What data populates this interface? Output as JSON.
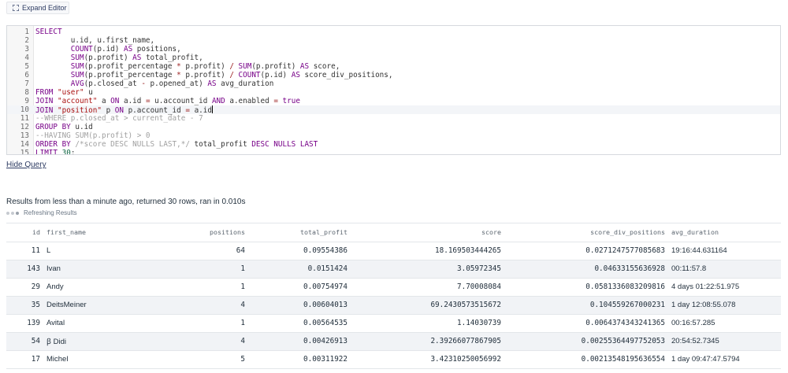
{
  "toolbar": {
    "expand_label": "Expand Editor",
    "hide_query_label": "Hide Query"
  },
  "editor": {
    "lines": [
      {
        "n": "1",
        "segments": [
          {
            "t": "SELECT",
            "c": "kw"
          }
        ]
      },
      {
        "n": "2",
        "segments": [
          {
            "t": "        u.id, u.first_name,",
            "c": ""
          }
        ]
      },
      {
        "n": "3",
        "segments": [
          {
            "t": "        ",
            "c": ""
          },
          {
            "t": "COUNT",
            "c": "kw"
          },
          {
            "t": "(p.id) ",
            "c": ""
          },
          {
            "t": "AS",
            "c": "kw"
          },
          {
            "t": " positions,",
            "c": ""
          }
        ]
      },
      {
        "n": "4",
        "segments": [
          {
            "t": "        ",
            "c": ""
          },
          {
            "t": "SUM",
            "c": "kw"
          },
          {
            "t": "(p.profit) ",
            "c": ""
          },
          {
            "t": "AS",
            "c": "kw"
          },
          {
            "t": " total_profit,",
            "c": ""
          }
        ]
      },
      {
        "n": "5",
        "segments": [
          {
            "t": "        ",
            "c": ""
          },
          {
            "t": "SUM",
            "c": "kw"
          },
          {
            "t": "(p.profit_percentage ",
            "c": ""
          },
          {
            "t": "*",
            "c": "op"
          },
          {
            "t": " p.profit) ",
            "c": ""
          },
          {
            "t": "/",
            "c": "op"
          },
          {
            "t": " ",
            "c": ""
          },
          {
            "t": "SUM",
            "c": "kw"
          },
          {
            "t": "(p.profit) ",
            "c": ""
          },
          {
            "t": "AS",
            "c": "kw"
          },
          {
            "t": " score,",
            "c": ""
          }
        ]
      },
      {
        "n": "6",
        "segments": [
          {
            "t": "        ",
            "c": ""
          },
          {
            "t": "SUM",
            "c": "kw"
          },
          {
            "t": "(p.profit_percentage ",
            "c": ""
          },
          {
            "t": "*",
            "c": "op"
          },
          {
            "t": " p.profit) ",
            "c": ""
          },
          {
            "t": "/",
            "c": "op"
          },
          {
            "t": " ",
            "c": ""
          },
          {
            "t": "COUNT",
            "c": "kw"
          },
          {
            "t": "(p.id) ",
            "c": ""
          },
          {
            "t": "AS",
            "c": "kw"
          },
          {
            "t": " score_div_positions,",
            "c": ""
          }
        ]
      },
      {
        "n": "7",
        "segments": [
          {
            "t": "        ",
            "c": ""
          },
          {
            "t": "AVG",
            "c": "kw"
          },
          {
            "t": "(p.closed_at ",
            "c": ""
          },
          {
            "t": "-",
            "c": "op"
          },
          {
            "t": " p.opened_at) ",
            "c": ""
          },
          {
            "t": "AS",
            "c": "kw"
          },
          {
            "t": " avg_duration",
            "c": ""
          }
        ]
      },
      {
        "n": "8",
        "segments": [
          {
            "t": "FROM",
            "c": "kw"
          },
          {
            "t": " ",
            "c": ""
          },
          {
            "t": "\"user\"",
            "c": "str"
          },
          {
            "t": " u",
            "c": ""
          }
        ]
      },
      {
        "n": "9",
        "segments": [
          {
            "t": "JOIN",
            "c": "kw"
          },
          {
            "t": " ",
            "c": ""
          },
          {
            "t": "\"account\"",
            "c": "str"
          },
          {
            "t": " a ",
            "c": ""
          },
          {
            "t": "ON",
            "c": "kw"
          },
          {
            "t": " a.id ",
            "c": ""
          },
          {
            "t": "=",
            "c": "op"
          },
          {
            "t": " u.account_id ",
            "c": ""
          },
          {
            "t": "AND",
            "c": "kw"
          },
          {
            "t": " a.enabled ",
            "c": ""
          },
          {
            "t": "=",
            "c": "op"
          },
          {
            "t": " ",
            "c": ""
          },
          {
            "t": "true",
            "c": "kw"
          }
        ]
      },
      {
        "n": "10",
        "active": true,
        "segments": [
          {
            "t": "JOIN",
            "c": "kw"
          },
          {
            "t": " ",
            "c": ""
          },
          {
            "t": "\"position\"",
            "c": "str"
          },
          {
            "t": " p ",
            "c": ""
          },
          {
            "t": "ON",
            "c": "kw"
          },
          {
            "t": " p.account_id ",
            "c": ""
          },
          {
            "t": "=",
            "c": "op"
          },
          {
            "t": " a.id",
            "c": ""
          }
        ]
      },
      {
        "n": "11",
        "segments": [
          {
            "t": "--WHERE p.closed_at > current_date - 7",
            "c": "cm"
          }
        ]
      },
      {
        "n": "12",
        "segments": [
          {
            "t": "GROUP BY",
            "c": "kw"
          },
          {
            "t": " u.id",
            "c": ""
          }
        ]
      },
      {
        "n": "13",
        "segments": [
          {
            "t": "--HAVING SUM(p.profit) > 0",
            "c": "cm"
          }
        ]
      },
      {
        "n": "14",
        "segments": [
          {
            "t": "ORDER BY",
            "c": "kw"
          },
          {
            "t": " ",
            "c": ""
          },
          {
            "t": "/*score DESC NULLS LAST,*/",
            "c": "cm"
          },
          {
            "t": " total_profit ",
            "c": ""
          },
          {
            "t": "DESC NULLS LAST",
            "c": "kw"
          }
        ]
      },
      {
        "n": "15",
        "segments": [
          {
            "t": "LIMIT",
            "c": "kw"
          },
          {
            "t": " ",
            "c": ""
          },
          {
            "t": "30",
            "c": "num"
          },
          {
            "t": ";",
            "c": ""
          }
        ]
      }
    ]
  },
  "results": {
    "summary": "Results from less than a minute ago, returned 30 rows, ran in 0.010s",
    "refreshing_label": "Refreshing Results",
    "columns": [
      "id",
      "first_name",
      "positions",
      "total_profit",
      "score",
      "score_div_positions",
      "avg_duration"
    ],
    "rows": [
      [
        "11",
        "L",
        "64",
        "0.09554386",
        "18.169503444265",
        "0.0271247577085683",
        "19:16:44.631164"
      ],
      [
        "143",
        "Ivan",
        "1",
        "0.0151424",
        "3.05972345",
        "0.04633155636928",
        "00:11:57.8"
      ],
      [
        "29",
        "Andy",
        "1",
        "0.00754974",
        "7.70008084",
        "0.0581336083209816",
        "4 days 01:22:51.975"
      ],
      [
        "35",
        "DeitsMeiner",
        "4",
        "0.00604013",
        "69.2430573515672",
        "0.104559267000231",
        "1 day 12:08:55.078"
      ],
      [
        "139",
        "Avital",
        "1",
        "0.00564535",
        "1.14030739",
        "0.0064374343241365",
        "00:16:57.285"
      ],
      [
        "54",
        "ꞵ Didi",
        "4",
        "0.00426913",
        "2.39266077867905",
        "0.00255364497752053",
        "20:54:52.7345"
      ],
      [
        "17",
        "Michel",
        "5",
        "0.00311922",
        "3.42310250056992",
        "0.00213548195636554",
        "1 day 09:47:47.5794"
      ]
    ]
  }
}
